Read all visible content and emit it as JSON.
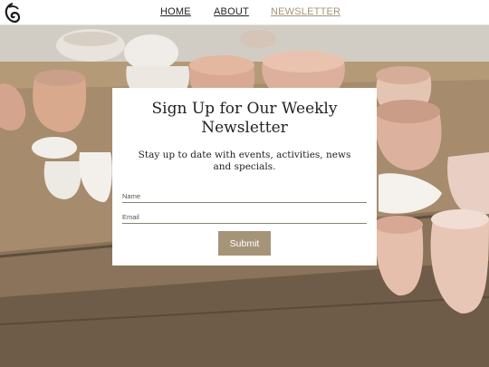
{
  "nav": {
    "logo_icon": "ceramic-bowls-logo-icon",
    "items": [
      {
        "label": "HOME"
      },
      {
        "label": "ABOUT"
      },
      {
        "label": "NEWSLETTER"
      }
    ],
    "active_color": "#a69478"
  },
  "signup": {
    "title": "Sign Up for Our Weekly Newsletter",
    "subtitle": "Stay up to date with events, activities, news and specials.",
    "name_placeholder": "Name",
    "email_placeholder": "Email",
    "submit_label": "Submit",
    "accent": "#a69478"
  }
}
